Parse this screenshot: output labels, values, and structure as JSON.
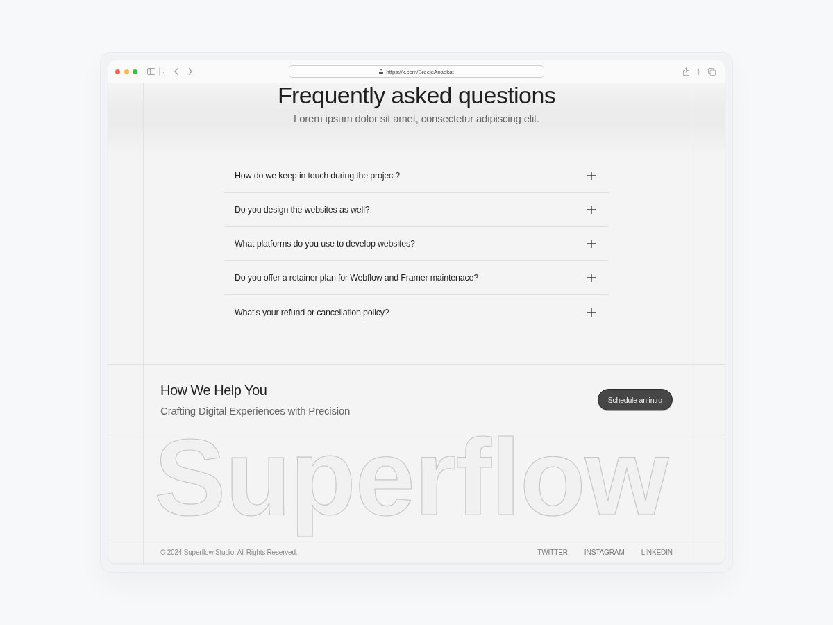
{
  "browser": {
    "url": "https://x.com/BreejeAnadkat"
  },
  "faq": {
    "title": "Frequently asked questions",
    "subtitle": "Lorem ipsum dolor sit amet, consectetur adipiscing elit.",
    "items": [
      {
        "question": "How do we keep in touch during the project?",
        "expanded": false
      },
      {
        "question": "Do you design the websites as well?",
        "expanded": false
      },
      {
        "question": "What platforms do you use to develop websites?",
        "expanded": false
      },
      {
        "question": "Do you offer a retainer plan for Webflow and Framer maintenace?",
        "expanded": false
      },
      {
        "question": "What's your refund or cancellation policy?",
        "expanded": false
      }
    ]
  },
  "cta": {
    "heading": "How We Help You",
    "subheading": "Crafting Digital Experiences with Precision",
    "button": "Schedule an intro"
  },
  "wordmark": "Superflow",
  "footer": {
    "copyright": "© 2024 Superflow Studio. All Rights Reserved.",
    "links": [
      "TWITTER",
      "INSTAGRAM",
      "LINKEDIN"
    ]
  }
}
